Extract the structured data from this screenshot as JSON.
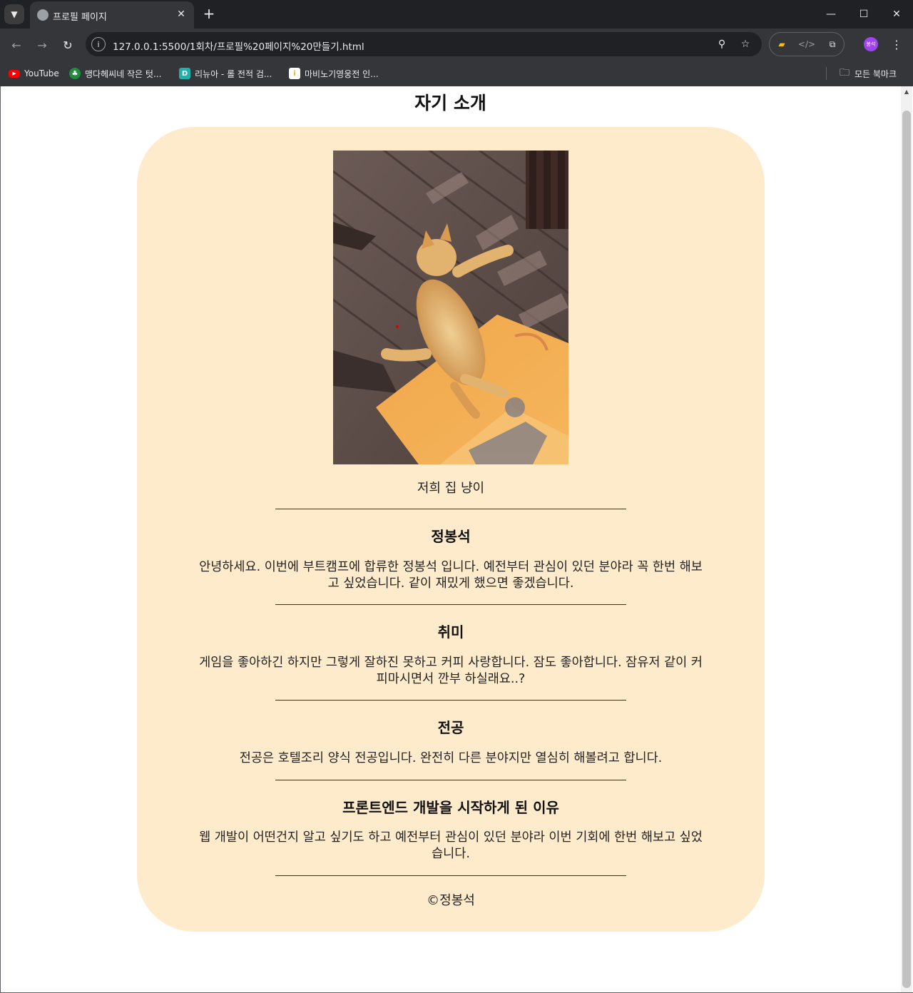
{
  "browser": {
    "tab_title": "프로필 페이지",
    "new_tab_label": "+",
    "url": "127.0.0.1:5500/1회차/프로필%20페이지%20만들기.html",
    "profile_initials": "봉석",
    "bookmarks": [
      {
        "label": "YouTube",
        "icon": "youtube-icon",
        "color": "#ff0000"
      },
      {
        "label": "맹다헤씨네 작은 텃...",
        "icon": "shield-icon",
        "color": "#1e8e3e"
      },
      {
        "label": "리뉴아 - 롤 전적 검...",
        "icon": "d-icon",
        "color": "#20b2aa"
      },
      {
        "label": "마비노기영웅전 인...",
        "icon": "bar-icon",
        "color": "#f4b400"
      }
    ],
    "all_bookmarks_label": "모든 북마크"
  },
  "page": {
    "title": "자기 소개",
    "photo_caption": "저희 집 냥이",
    "name_heading": "정봉석",
    "intro": "안녕하세요. 이번에 부트캠프에 합류한 정봉석 입니다. 예전부터 관심이 있던 분야라 꼭 한번 해보고 싶었습니다. 같이 재밌게 했으면 좋겠습니다.",
    "hobby_heading": "취미",
    "hobby_body": "게임을 좋아하긴 하지만 그렇게 잘하진 못하고 커피 사랑합니다. 잠도 좋아합니다. 잠유저 같이 커피마시면서 깐부 하실래요..?",
    "major_heading": "전공",
    "major_body": "전공은 호텔조리 양식 전공입니다. 완전히 다른 분야지만 열심히 해볼려고 합니다.",
    "reason_heading": "프론트엔드 개발을 시작하게 된 이유",
    "reason_body": "웹 개발이 어떤건지 알고 싶기도 하고 예전부터 관심이 있던 분야라 이번 기회에 한번 해보고 싶었습니다.",
    "footer": "©정봉석"
  },
  "colors": {
    "card_bg": "#feebcc",
    "chrome_bg": "#202124"
  }
}
